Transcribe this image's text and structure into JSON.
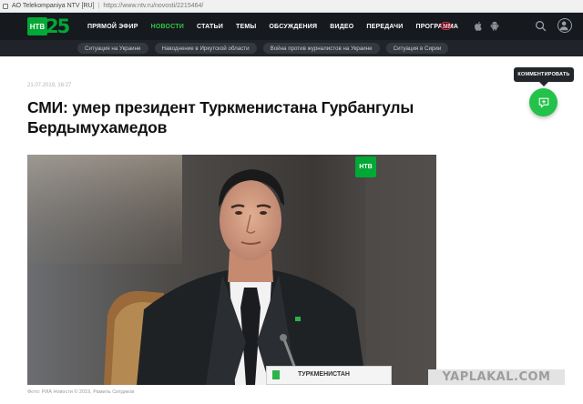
{
  "browser": {
    "site_label": "AO Telekompaniya NTV [RU]",
    "url": "https://www.ntv.ru/novosti/2215464/"
  },
  "header": {
    "logo_text": "НТВ",
    "logo_number": "25",
    "nav": [
      {
        "label": "ПРЯМОЙ ЭФИР",
        "active": false
      },
      {
        "label": "НОВОСТИ",
        "active": true
      },
      {
        "label": "СТАТЬИ",
        "active": false
      },
      {
        "label": "ТЕМЫ",
        "active": false
      },
      {
        "label": "ОБСУЖДЕНИЯ",
        "active": false
      },
      {
        "label": "ВИДЕО",
        "active": false
      },
      {
        "label": "ПЕРЕДАЧИ",
        "active": false
      },
      {
        "label": "ПРОГРАММА",
        "active": false
      }
    ],
    "age_badge": "18+",
    "brand_color": "#00a835",
    "active_color": "#31c646"
  },
  "tags": [
    "Ситуация на Украине",
    "Наводнение в Иркутской области",
    "Война против журналистов на Украине",
    "Ситуация в Сирии"
  ],
  "article": {
    "date": "21.07.2019, 16:27",
    "headline": "СМИ: умер президент Туркменистана Гурбангулы Бердымухамедов",
    "photo_logo": "НТВ",
    "nameplate": "ТУРКМЕНИСТАН",
    "caption": "Фото: РИА Новости © 2019, Рамиль Ситдиков"
  },
  "comment": {
    "tooltip": "КОММЕНТИРОВАТЬ",
    "button_color": "#23c24a"
  },
  "watermark": "YAPLAKAL.COM"
}
